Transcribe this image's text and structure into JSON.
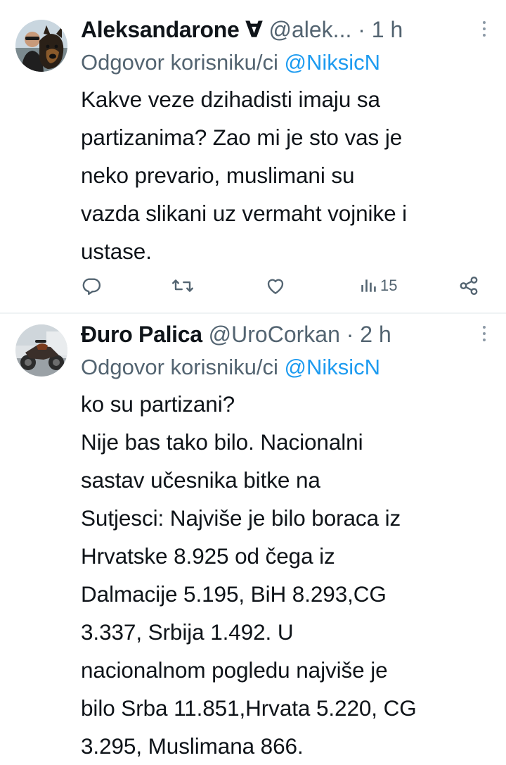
{
  "tweets": [
    {
      "display_name": "Aleksandarone Ɐ",
      "handle": "@alek...",
      "dot": "·",
      "time": "1 h",
      "reply_prefix": "Odgovor korisniku/ci",
      "reply_mention": "@NiksicN",
      "text": "Kakve veze dzihadisti imaju sa\npartizanima?  Zao mi je sto vas je\nneko prevario, muslimani su\nvazda slikani uz vermaht vojnike i\nustase.",
      "actions": {
        "reply_icon": "reply-icon",
        "retweet_icon": "retweet-icon",
        "like_icon": "heart-icon",
        "views_icon": "views-icon",
        "views_count": "15",
        "share_icon": "share-icon"
      }
    },
    {
      "display_name": "Đuro Palica",
      "handle": "@UroCorkan",
      "dot": "·",
      "time": "2 h",
      "reply_prefix": "Odgovor korisniku/ci",
      "reply_mention": "@NiksicN",
      "text": "ko  su partizani?\nNije bas tako bilo. Nacionalni\nsastav učesnika bitke na\nSutjesci: Najviše je bilo boraca iz\nHrvatske 8.925 od čega iz\nDalmacije 5.195, BiH 8.293,CG\n3.337, Srbija 1.492. U\nnacionalnom pogledu najviše je\nbilo Srba 11.851,Hrvata 5.220, CG\n3.295, Muslimana 866."
    }
  ],
  "colors": {
    "text": "#0f1419",
    "secondary": "#536471",
    "link": "#1d9bf0",
    "divider": "#eff3f4"
  }
}
